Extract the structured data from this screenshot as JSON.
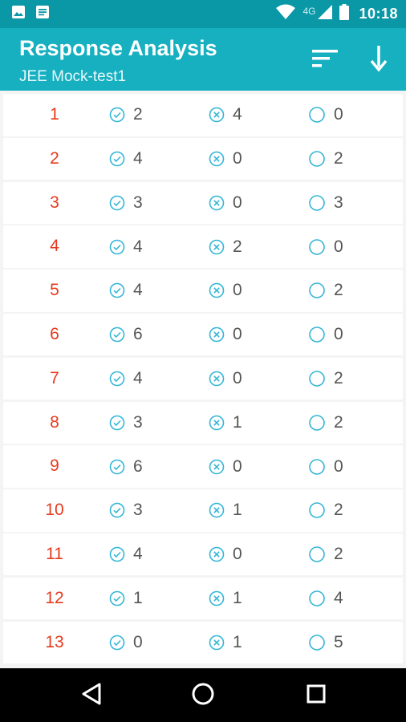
{
  "status_bar": {
    "time": "10:18",
    "network": "4G",
    "icons": [
      "image-icon",
      "message-icon",
      "wifi-icon",
      "signal-icon",
      "battery-icon"
    ]
  },
  "app_bar": {
    "title": "Response Analysis",
    "subtitle": "JEE Mock-test1",
    "actions": [
      "sort-icon",
      "download-arrow-icon"
    ]
  },
  "colors": {
    "status_bar": "#0a97a6",
    "app_bar": "#16b0c0",
    "question_number": "#e53a1d",
    "icon_accent": "#35b6d6",
    "value_text": "#555555"
  },
  "rows": [
    {
      "q": "1",
      "correct": "2",
      "wrong": "4",
      "skipped": "0"
    },
    {
      "q": "2",
      "correct": "4",
      "wrong": "0",
      "skipped": "2"
    },
    {
      "q": "3",
      "correct": "3",
      "wrong": "0",
      "skipped": "3"
    },
    {
      "q": "4",
      "correct": "4",
      "wrong": "2",
      "skipped": "0"
    },
    {
      "q": "5",
      "correct": "4",
      "wrong": "0",
      "skipped": "2"
    },
    {
      "q": "6",
      "correct": "6",
      "wrong": "0",
      "skipped": "0"
    },
    {
      "q": "7",
      "correct": "4",
      "wrong": "0",
      "skipped": "2"
    },
    {
      "q": "8",
      "correct": "3",
      "wrong": "1",
      "skipped": "2"
    },
    {
      "q": "9",
      "correct": "6",
      "wrong": "0",
      "skipped": "0"
    },
    {
      "q": "10",
      "correct": "3",
      "wrong": "1",
      "skipped": "2"
    },
    {
      "q": "11",
      "correct": "4",
      "wrong": "0",
      "skipped": "2"
    },
    {
      "q": "12",
      "correct": "1",
      "wrong": "1",
      "skipped": "4"
    },
    {
      "q": "13",
      "correct": "0",
      "wrong": "1",
      "skipped": "5"
    }
  ],
  "nav_bar": {
    "buttons": [
      "back-triangle-icon",
      "home-circle-icon",
      "recents-square-icon"
    ]
  }
}
